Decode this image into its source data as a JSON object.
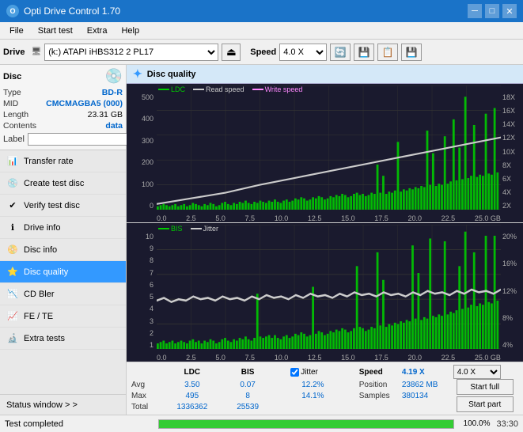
{
  "titlebar": {
    "title": "Opti Drive Control 1.70",
    "icon": "O",
    "minimize_label": "─",
    "maximize_label": "□",
    "close_label": "✕"
  },
  "menubar": {
    "items": [
      "File",
      "Start test",
      "Extra",
      "Help"
    ]
  },
  "drivebar": {
    "label": "Drive",
    "drive_value": "(k:) ATAPI iHBS312  2 PL17",
    "speed_label": "Speed",
    "speed_value": "4.0 X"
  },
  "disc": {
    "title": "Disc",
    "type_label": "Type",
    "type_value": "BD-R",
    "mid_label": "MID",
    "mid_value": "CMCMAGBA5 (000)",
    "length_label": "Length",
    "length_value": "23.31 GB",
    "contents_label": "Contents",
    "contents_value": "data",
    "label_label": "Label",
    "label_value": ""
  },
  "nav": {
    "items": [
      {
        "id": "transfer-rate",
        "label": "Transfer rate",
        "icon": "📊"
      },
      {
        "id": "create-test-disc",
        "label": "Create test disc",
        "icon": "💿"
      },
      {
        "id": "verify-test-disc",
        "label": "Verify test disc",
        "icon": "✔"
      },
      {
        "id": "drive-info",
        "label": "Drive info",
        "icon": "ℹ"
      },
      {
        "id": "disc-info",
        "label": "Disc info",
        "icon": "📀"
      },
      {
        "id": "disc-quality",
        "label": "Disc quality",
        "icon": "⭐",
        "active": true
      },
      {
        "id": "cd-bler",
        "label": "CD Bler",
        "icon": "📉"
      },
      {
        "id": "fe-te",
        "label": "FE / TE",
        "icon": "📈"
      },
      {
        "id": "extra-tests",
        "label": "Extra tests",
        "icon": "🔬"
      }
    ],
    "status_window": "Status window > >"
  },
  "content": {
    "header": "Disc quality",
    "chart1": {
      "legend": [
        {
          "label": "LDC",
          "color": "#00cc00"
        },
        {
          "label": "Read speed",
          "color": "#ffffff"
        },
        {
          "label": "Write speed",
          "color": "#ff00ff"
        }
      ],
      "y_left": [
        "500",
        "400",
        "300",
        "200",
        "100",
        "0"
      ],
      "y_right": [
        "18X",
        "16X",
        "14X",
        "12X",
        "10X",
        "8X",
        "6X",
        "4X",
        "2X"
      ],
      "x_axis": [
        "0.0",
        "2.5",
        "5.0",
        "7.5",
        "10.0",
        "12.5",
        "15.0",
        "17.5",
        "20.0",
        "22.5",
        "25.0"
      ],
      "x_unit": "GB"
    },
    "chart2": {
      "legend": [
        {
          "label": "BIS",
          "color": "#00cc00"
        },
        {
          "label": "Jitter",
          "color": "#ffffff"
        }
      ],
      "y_left": [
        "10",
        "9",
        "8",
        "7",
        "6",
        "5",
        "4",
        "3",
        "2",
        "1"
      ],
      "y_right": [
        "20%",
        "16%",
        "12%",
        "8%",
        "4%"
      ],
      "x_axis": [
        "0.0",
        "2.5",
        "5.0",
        "7.5",
        "10.0",
        "12.5",
        "15.0",
        "17.5",
        "20.0",
        "22.5",
        "25.0"
      ],
      "x_unit": "GB"
    },
    "stats": {
      "headers": [
        "LDC",
        "BIS",
        "",
        "Jitter",
        "Speed"
      ],
      "avg_label": "Avg",
      "avg_ldc": "3.50",
      "avg_bis": "0.07",
      "avg_jitter": "12.2%",
      "speed_label": "Speed",
      "speed_value": "4.19 X",
      "speed_select": "4.0 X",
      "max_label": "Max",
      "max_ldc": "495",
      "max_bis": "8",
      "max_jitter": "14.1%",
      "position_label": "Position",
      "position_value": "23862 MB",
      "total_label": "Total",
      "total_ldc": "1336362",
      "total_bis": "25539",
      "samples_label": "Samples",
      "samples_value": "380134",
      "jitter_checked": true,
      "start_full": "Start full",
      "start_part": "Start part"
    }
  },
  "statusbar": {
    "text": "Test completed",
    "progress": 100,
    "progress_text": "100.0%",
    "time": "33:30"
  },
  "colors": {
    "ldc_bar": "#00cc00",
    "bis_bar": "#00cc00",
    "read_speed_line": "#cccccc",
    "jitter_line": "#cccccc",
    "write_speed_line": "#ff00ff",
    "accent": "#3399ff",
    "progress": "#33cc33"
  }
}
